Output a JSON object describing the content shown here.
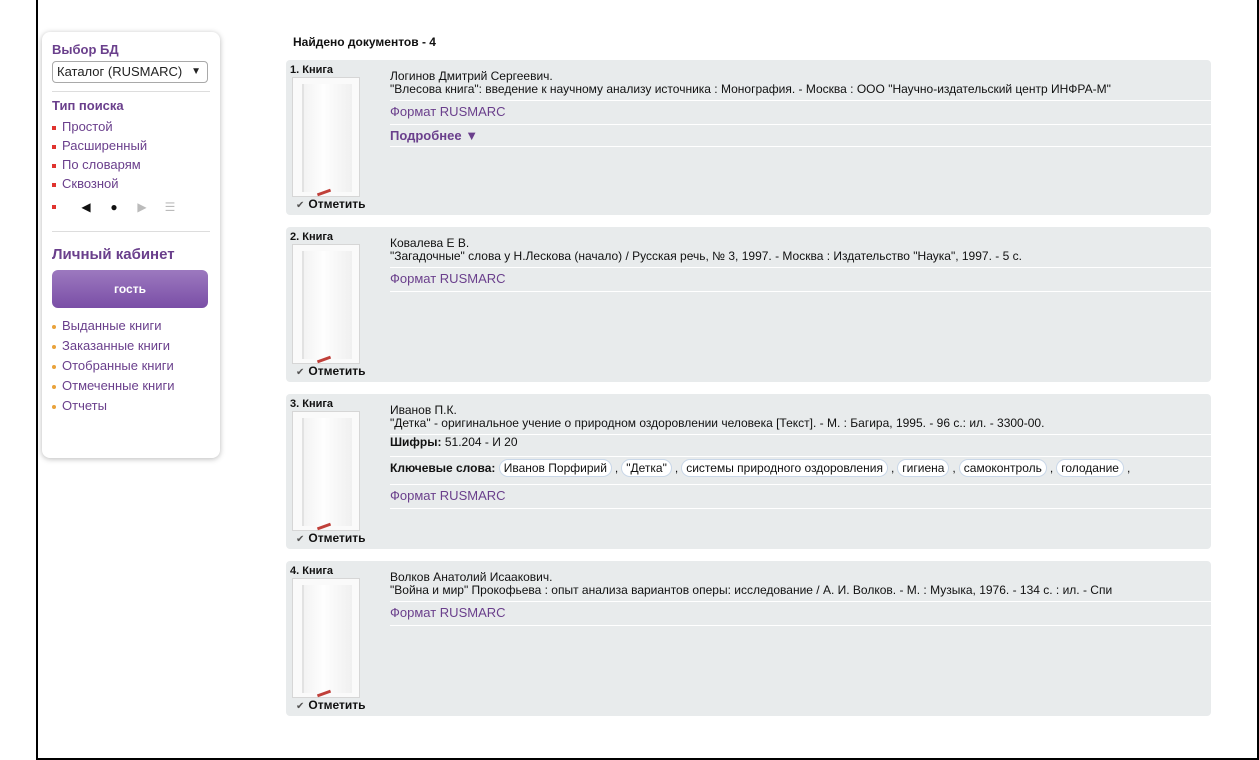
{
  "sidebar": {
    "db_title": "Выбор БД",
    "db_selected": "Каталог (RUSMARC)",
    "search_type_title": "Тип поиска",
    "search_types": [
      "Простой",
      "Расширенный",
      "По словарям",
      "Сквозной"
    ],
    "pager": {
      "prev": "◀",
      "dot": "●",
      "next": "▶",
      "menu": "☰"
    },
    "cabinet_title": "Личный кабинет",
    "guest_label": "гость",
    "cabinet_links": [
      "Выданные книги",
      "Заказанные книги",
      "Отобранные книги",
      "Отмеченные книги",
      "Отчеты"
    ]
  },
  "results": {
    "found_label": "Найдено документов - 4",
    "mark_label": "Отметить",
    "format_label": "Формат RUSMARC",
    "more_label": "Подробнее ▼",
    "cipher_label": "Шифры:",
    "keywords_label": "Ключевые слова:",
    "records": [
      {
        "num": "1. Книга",
        "author": "Логинов Дмитрий Сергеевич.",
        "title": "\"Влесова книга\": введение к научному анализу источника : Монография. - Москва : ООО \"Научно-издательский центр ИНФРА-М\""
      },
      {
        "num": "2. Книга",
        "author": "Ковалева Е В.",
        "title": "\"Загадочные\" слова у Н.Лескова (начало) / Русская речь, № 3, 1997. - Москва : Издательство \"Наука\", 1997. - 5 с."
      },
      {
        "num": "3. Книга",
        "author": "Иванов П.К.",
        "title": "\"Детка\" - оригинальное учение о природном оздоровлении человека [Текст]. - М. : Багира, 1995. - 96 с.: ил. - 3300-00.",
        "cipher": "51.204 - И 20",
        "keywords": [
          "Иванов Порфирий",
          "\"Детка\"",
          "системы природного оздоровления",
          "гигиена",
          "самоконтроль",
          "голодание"
        ]
      },
      {
        "num": "4. Книга",
        "author": "Волков Анатолий Исаакович.",
        "title": "\"Война и мир\" Прокофьева : опыт анализа вариантов оперы: исследование / А. И. Волков. - М. : Музыка, 1976. - 134 с. : ил. - Спи"
      }
    ]
  }
}
